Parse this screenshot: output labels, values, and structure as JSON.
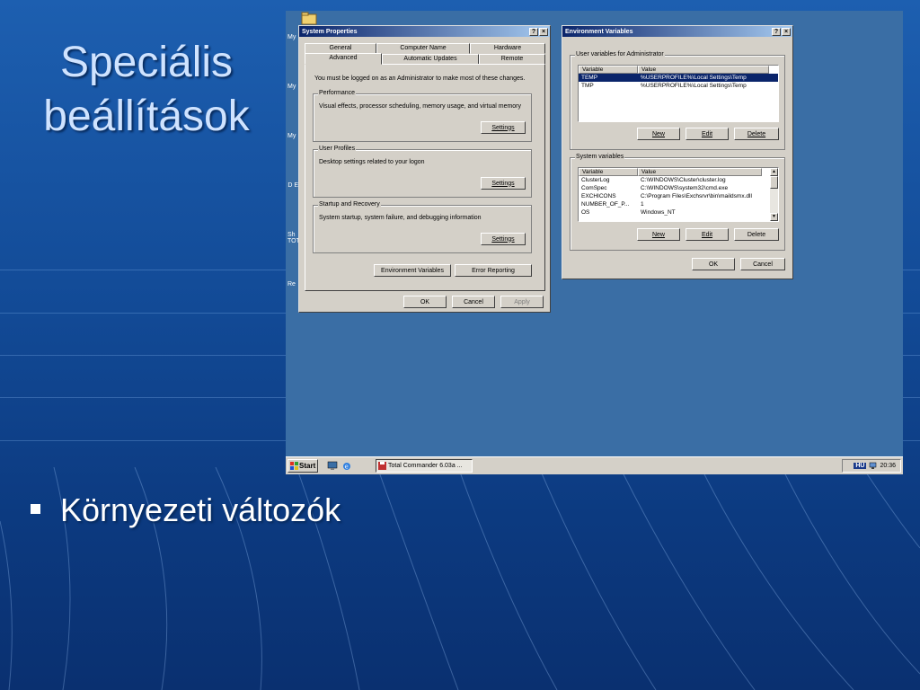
{
  "slide": {
    "title_line1": "Speciális",
    "title_line2": "beállítások",
    "bullet": "Környezeti változók"
  },
  "desktop": {
    "icon_labels": [
      "My",
      "My",
      "My",
      "D E",
      "Sh TOTA",
      "Re"
    ]
  },
  "system_properties": {
    "title": "System Properties",
    "help_btn": "?",
    "close_btn": "×",
    "tabs_row1": [
      "General",
      "Computer Name",
      "Hardware"
    ],
    "tabs_row2": [
      "Advanced",
      "Automatic Updates",
      "Remote"
    ],
    "active_tab": "Advanced",
    "admin_note": "You must be logged on as an Administrator to make most of these changes.",
    "performance": {
      "label": "Performance",
      "desc": "Visual effects, processor scheduling, memory usage, and virtual memory",
      "button": "Settings"
    },
    "user_profiles": {
      "label": "User Profiles",
      "desc": "Desktop settings related to your logon",
      "button": "Settings"
    },
    "startup_recovery": {
      "label": "Startup and Recovery",
      "desc": "System startup, system failure, and debugging information",
      "button": "Settings"
    },
    "env_button": "Environment Variables",
    "error_button": "Error Reporting",
    "ok": "OK",
    "cancel": "Cancel",
    "apply": "Apply"
  },
  "env_variables": {
    "title": "Environment Variables",
    "help_btn": "?",
    "close_btn": "×",
    "user_group": "User variables for Administrator",
    "columns": [
      "Variable",
      "Value"
    ],
    "user_vars": [
      {
        "name": "TEMP",
        "value": "%USERPROFILE%\\Local Settings\\Temp",
        "selected": true
      },
      {
        "name": "TMP",
        "value": "%USERPROFILE%\\Local Settings\\Temp",
        "selected": false
      }
    ],
    "system_group": "System variables",
    "system_vars": [
      {
        "name": "ClusterLog",
        "value": "C:\\WINDOWS\\Cluster\\cluster.log"
      },
      {
        "name": "ComSpec",
        "value": "C:\\WINDOWS\\system32\\cmd.exe"
      },
      {
        "name": "EXCHICONS",
        "value": "C:\\Program Files\\Exchsrvr\\bin\\maildsmx.dll"
      },
      {
        "name": "NUMBER_OF_P...",
        "value": "1"
      },
      {
        "name": "OS",
        "value": "Windows_NT"
      }
    ],
    "new": "New",
    "edit": "Edit",
    "delete": "Delete",
    "ok": "OK",
    "cancel": "Cancel"
  },
  "taskbar": {
    "start": "Start",
    "task": "Total Commander 6.03a ...",
    "lang": "HU",
    "clock": "20:36"
  },
  "colors": {
    "desktop": "#3a6ea5",
    "title_active": "#0a246a",
    "window_face": "#d4d0c8"
  }
}
